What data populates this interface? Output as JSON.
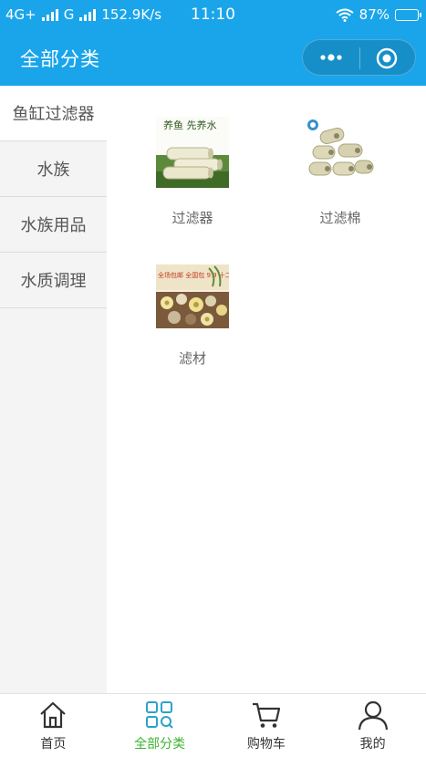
{
  "status_bar": {
    "network": "4G+",
    "network2": "G",
    "speed": "152.9K/s",
    "time": "11:10",
    "battery": "87%",
    "battery_level": 0.87
  },
  "header": {
    "title": "全部分类"
  },
  "sidebar": {
    "items": [
      {
        "label": "鱼缸过滤器"
      },
      {
        "label": "水族"
      },
      {
        "label": "水族用品"
      },
      {
        "label": "水质调理"
      }
    ]
  },
  "products": [
    {
      "label": "过滤器",
      "image_text": "养鱼 先养水"
    },
    {
      "label": "过滤棉"
    },
    {
      "label": "滤材",
      "image_text": "全场包邮 全国包 9.9 十二合一滤材"
    }
  ],
  "tabbar": {
    "items": [
      {
        "label": "首页",
        "icon": "home-icon"
      },
      {
        "label": "全部分类",
        "icon": "category-grid-icon"
      },
      {
        "label": "购物车",
        "icon": "cart-icon"
      },
      {
        "label": "我的",
        "icon": "profile-icon"
      }
    ]
  },
  "colors": {
    "header_bg": "#1aa5ea",
    "tab_active": "#3cb431",
    "sidebar_bg": "#f4f4f4"
  }
}
